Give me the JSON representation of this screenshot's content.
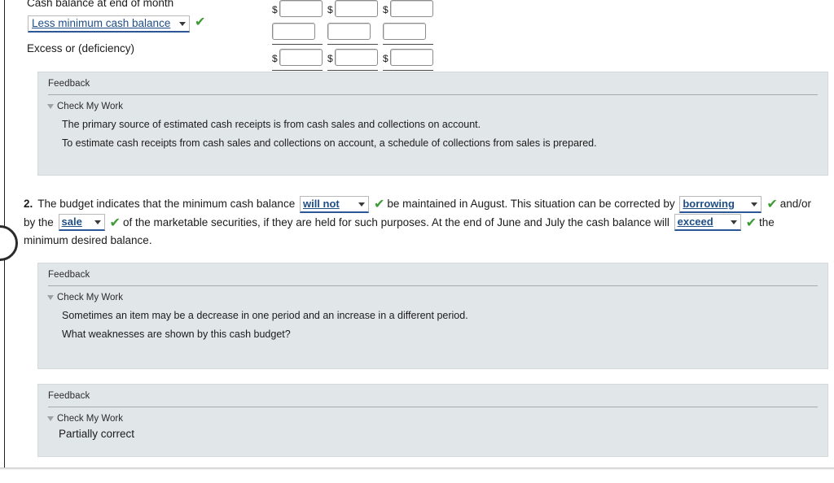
{
  "schedule": {
    "rows": [
      {
        "label": "Cash balance at end of month"
      },
      {
        "label": "Excess or (deficiency)"
      }
    ],
    "dropdown": {
      "value": "Less minimum cash balance",
      "status_icon": "check-icon",
      "status": "✔"
    },
    "columns": [
      {
        "cells": [
          {
            "dollar": "$",
            "value": ""
          },
          {
            "dollar": "",
            "value": ""
          },
          {
            "dollar": "$",
            "value": ""
          }
        ]
      },
      {
        "cells": [
          {
            "dollar": "$",
            "value": ""
          },
          {
            "dollar": "",
            "value": ""
          },
          {
            "dollar": "$",
            "value": ""
          }
        ]
      },
      {
        "cells": [
          {
            "dollar": "$",
            "value": ""
          },
          {
            "dollar": "",
            "value": ""
          },
          {
            "dollar": "$",
            "value": ""
          }
        ]
      }
    ]
  },
  "feedback_1": {
    "title": "Feedback",
    "check_my_work": "Check My Work",
    "line1": "The primary source of estimated cash receipts is from cash sales and collections on account.",
    "line2": "To estimate cash receipts from cash sales and collections on account, a schedule of collections from sales is prepared."
  },
  "question2": {
    "number": "2.",
    "t1": "The budget indicates that the minimum cash balance",
    "d1": "will not",
    "t2": "be maintained in August. This situation can be corrected by",
    "d2": "borrowing",
    "t3": "and/or by the",
    "d3": "sale",
    "t4": "of the marketable securities, if they are held for such purposes. At the end of June and July the cash balance will",
    "d4": "exceed",
    "t5": "the minimum desired balance.",
    "status": "✔"
  },
  "feedback_2": {
    "title": "Feedback",
    "check_my_work": "Check My Work",
    "line1": "Sometimes an item may be a decrease in one period and an increase in a different period.",
    "line2": "What weaknesses are shown by this cash budget?"
  },
  "feedback_3": {
    "title": "Feedback",
    "check_my_work": "Check My Work",
    "line1": "Partially correct"
  },
  "colors": {
    "feedback_bg": "#e1e6e8",
    "dropdown_text": "#1f4e87",
    "dropdown_underline": "#2b5796",
    "check_green": "#3d9b35"
  }
}
